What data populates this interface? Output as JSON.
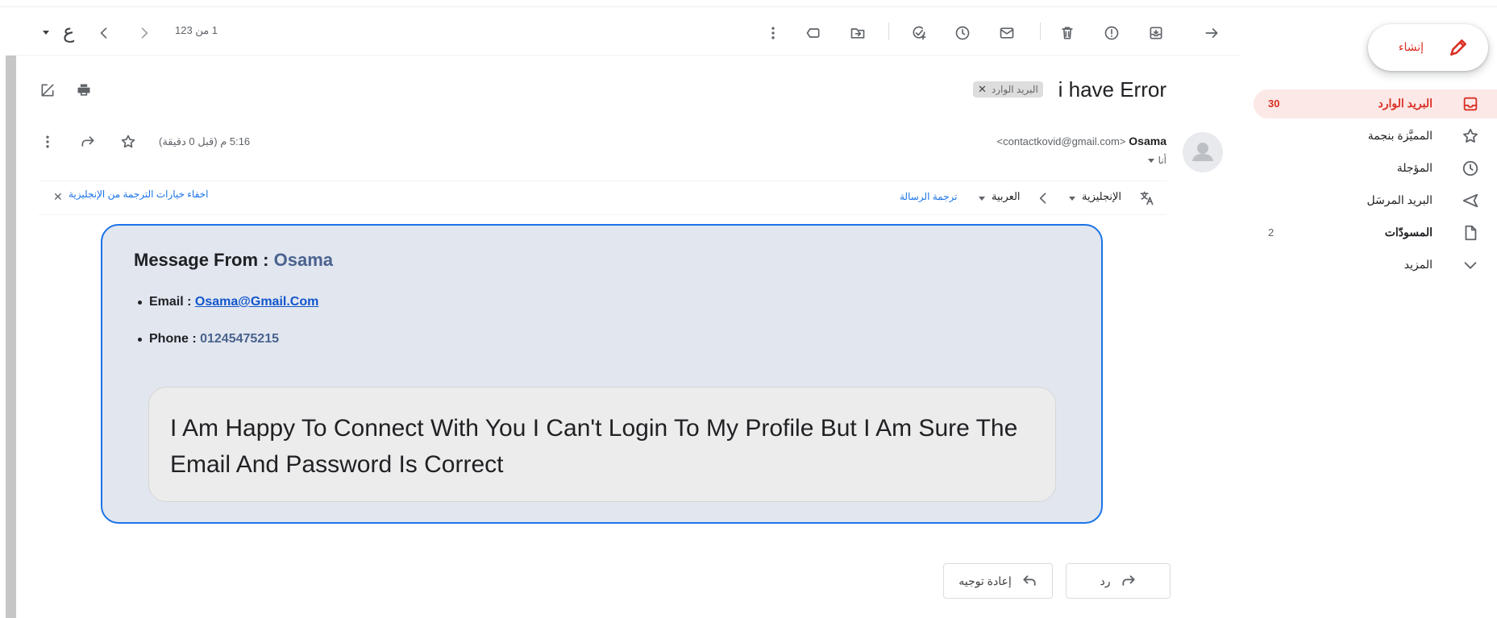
{
  "toolbar": {
    "pagination": "1 من 123",
    "lang_glyph": "ع"
  },
  "compose": {
    "label": "إنشاء"
  },
  "sidebar": {
    "items": [
      {
        "label": "البريد الوارد",
        "count": "30",
        "icon": "inbox-icon"
      },
      {
        "label": "المميَّزة بنجمة",
        "count": "",
        "icon": "star-icon"
      },
      {
        "label": "المؤجلة",
        "count": "",
        "icon": "clock-icon"
      },
      {
        "label": "البريد المرسَل",
        "count": "",
        "icon": "send-icon"
      },
      {
        "label": "المسودّات",
        "count": "2",
        "icon": "draft-icon"
      },
      {
        "label": "المزيد",
        "count": "",
        "icon": "chevron-down-icon"
      }
    ]
  },
  "email": {
    "subject": "i have Error",
    "label_chip": "البريد الوارد",
    "sender_name": "Osama",
    "sender_email": "<contactkovid@gmail.com>",
    "to": "أنا",
    "time": "5:16 م (قبل 0 دقيقة)"
  },
  "translate": {
    "from_lang": "الإنجليزية",
    "to_lang": "العربية",
    "translate_link": "ترجمة الرسالة",
    "hide_link": "اخفاء خيارات الترجمة من الإنجليزية"
  },
  "message": {
    "title_prefix": "Message From : ",
    "title_name": "Osama",
    "email_label": "Email : ",
    "email_value": "Osama@Gmail.Com",
    "phone_label": "Phone : ",
    "phone_value": "01245475215",
    "body": "I Am Happy To Connect With You I Can't Login To My Profile But I Am Sure The Email And Password Is Correct"
  },
  "actions": {
    "reply": "رد",
    "forward": "إعادة توجيه"
  },
  "colors": {
    "accent": "#d93025",
    "link": "#1a73e8",
    "card_bg": "#e1e6ef",
    "card_border": "#1a73e8"
  }
}
